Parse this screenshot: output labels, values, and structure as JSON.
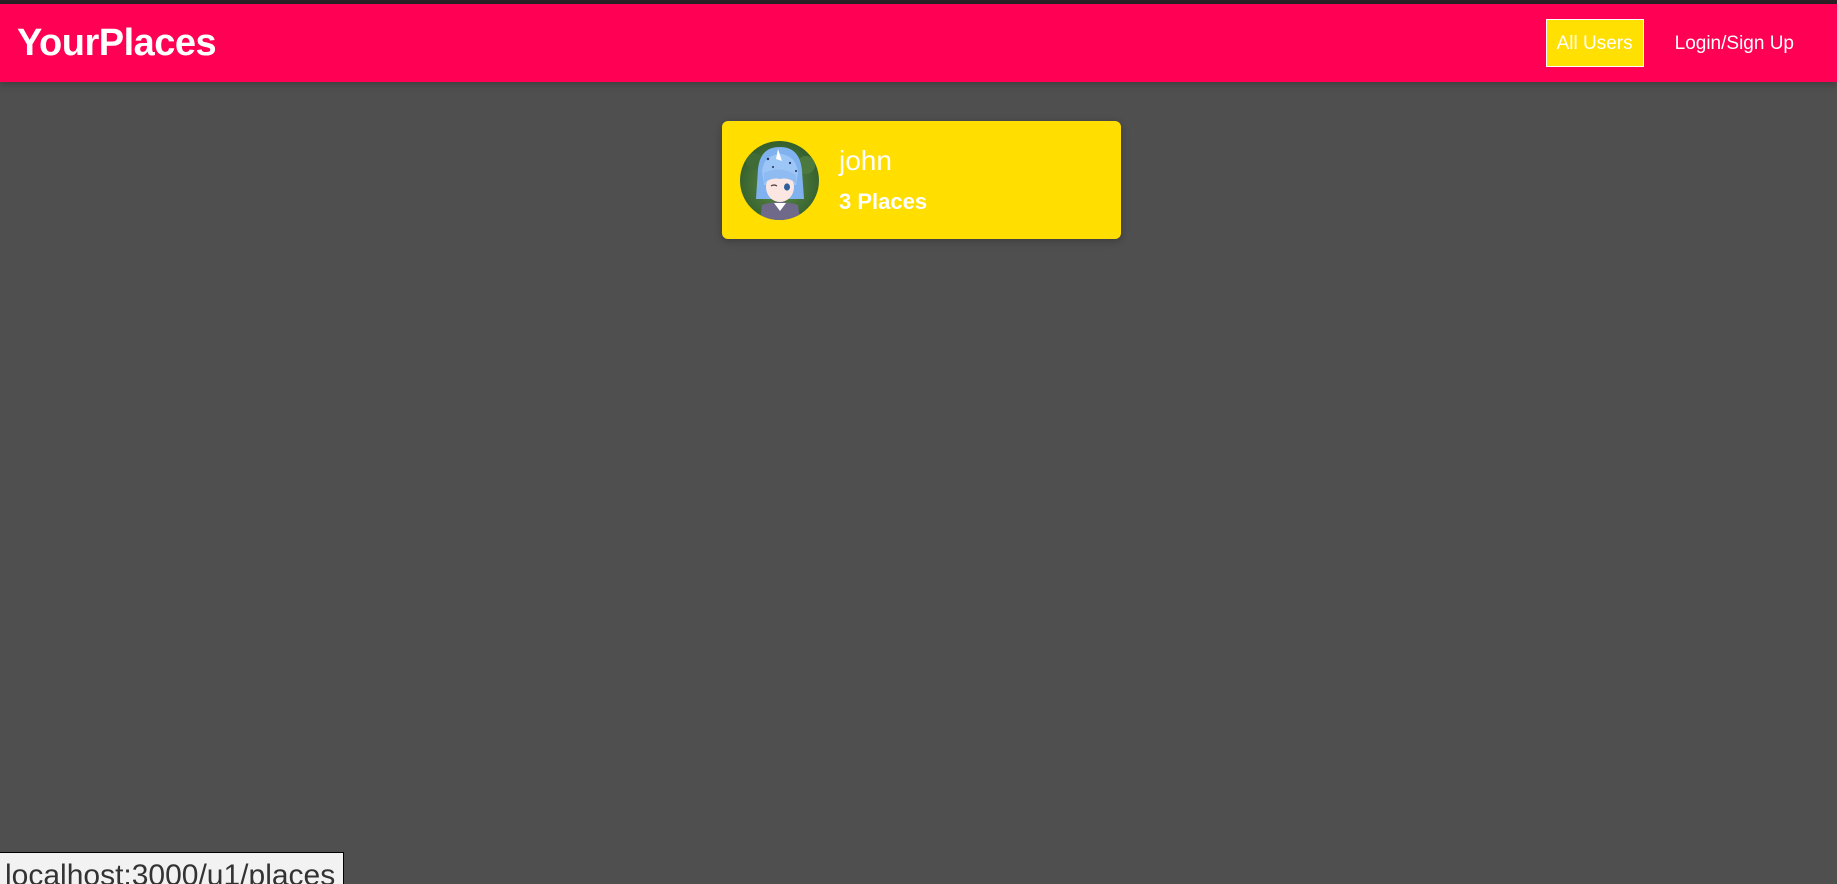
{
  "header": {
    "logo": "YourPlaces",
    "nav": [
      {
        "label": "All Users",
        "active": true
      },
      {
        "label": "Login/Sign Up",
        "active": false
      }
    ]
  },
  "users": [
    {
      "name": "john",
      "places": "3 Places"
    }
  ],
  "status_bar": {
    "url": "localhost:3000/u1/places"
  },
  "colors": {
    "header_bg": "#ff0055",
    "card_bg": "#ffde00",
    "active_nav_bg": "#ffe000",
    "page_bg": "#4f4f4f"
  }
}
